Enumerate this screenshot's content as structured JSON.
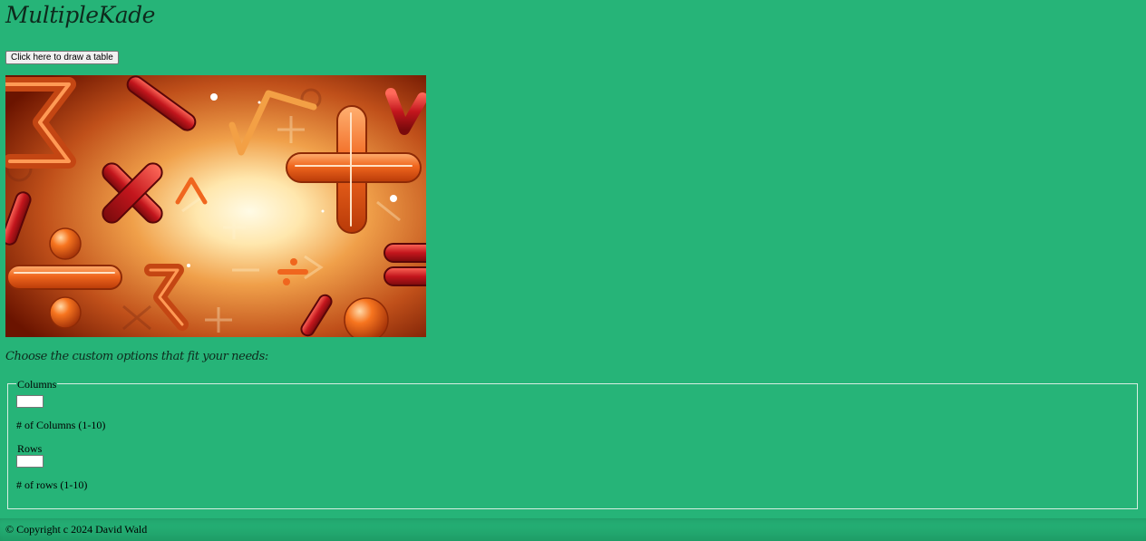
{
  "header": {
    "title": "MultipleKade"
  },
  "toolbar": {
    "draw_button_label": "Click here to draw a table"
  },
  "intro": {
    "text": "Choose the custom options that fit your needs:"
  },
  "options": {
    "columns": {
      "legend": "Columns",
      "value": "",
      "hint": "# of Columns (1-10)"
    },
    "rows": {
      "label": "Rows",
      "value": "",
      "hint": "# of rows (1-10)"
    }
  },
  "footer": {
    "copyright": "© Copyright c 2024 David Wald"
  },
  "colors": {
    "page_background": "#26b478",
    "hero_center": "#fff2cf",
    "hero_edge": "#6b1400",
    "symbol_orange": "#f0661e",
    "symbol_red": "#b4141a"
  },
  "hero_image": {
    "icons": [
      "plus-icon",
      "times-icon",
      "minus-icon",
      "divide-icon",
      "sigma-icon",
      "caret-icon",
      "sphere-icon"
    ]
  }
}
